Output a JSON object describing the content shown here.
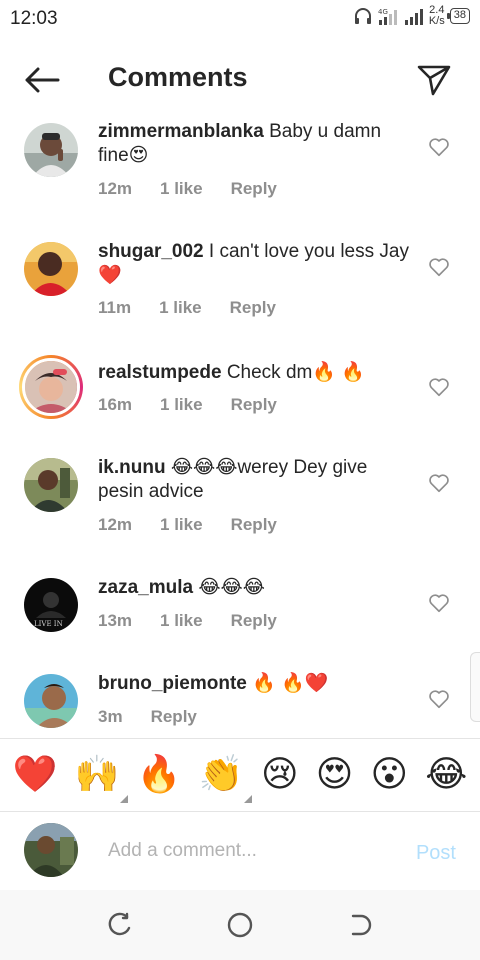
{
  "status_bar": {
    "time": "12:03",
    "network": "4G",
    "speed_value": "2.4",
    "speed_unit": "K/s",
    "battery": "38"
  },
  "header": {
    "title": "Comments",
    "back_icon": "back-arrow-icon",
    "share_icon": "send-icon"
  },
  "comments": [
    {
      "username": "zimmermanblanka",
      "text": "Baby u damn fine😍",
      "time": "12m",
      "likes": "1 like",
      "reply": "Reply"
    },
    {
      "username": "shugar_002",
      "text": "I can't love you less Jay ❤️",
      "time": "11m",
      "likes": "1 like",
      "reply": "Reply"
    },
    {
      "username": "realstumpede",
      "text": "Check dm🔥 🔥",
      "time": "16m",
      "likes": "1 like",
      "reply": "Reply"
    },
    {
      "username": "ik.nunu",
      "text": "😂😂😂werey Dey give pesin advice",
      "time": "12m",
      "likes": "1 like",
      "reply": "Reply"
    },
    {
      "username": "zaza_mula",
      "text": "😂😂😂",
      "time": "13m",
      "likes": "1 like",
      "reply": "Reply"
    },
    {
      "username": "bruno_piemonte",
      "text": "🔥 🔥❤️",
      "time": "3m",
      "likes": "",
      "reply": "Reply"
    }
  ],
  "avatar_5_text": "LIVE IN",
  "emoji_bar": [
    "❤️",
    "🙌",
    "🔥",
    "👏",
    "😢",
    "😍",
    "😮",
    "😂"
  ],
  "input": {
    "placeholder": "Add a comment...",
    "post_label": "Post"
  },
  "colors": {
    "post_disabled": "#b2dffc",
    "meta_grey": "#8e8e8e",
    "heart_red": "#e0245e"
  }
}
